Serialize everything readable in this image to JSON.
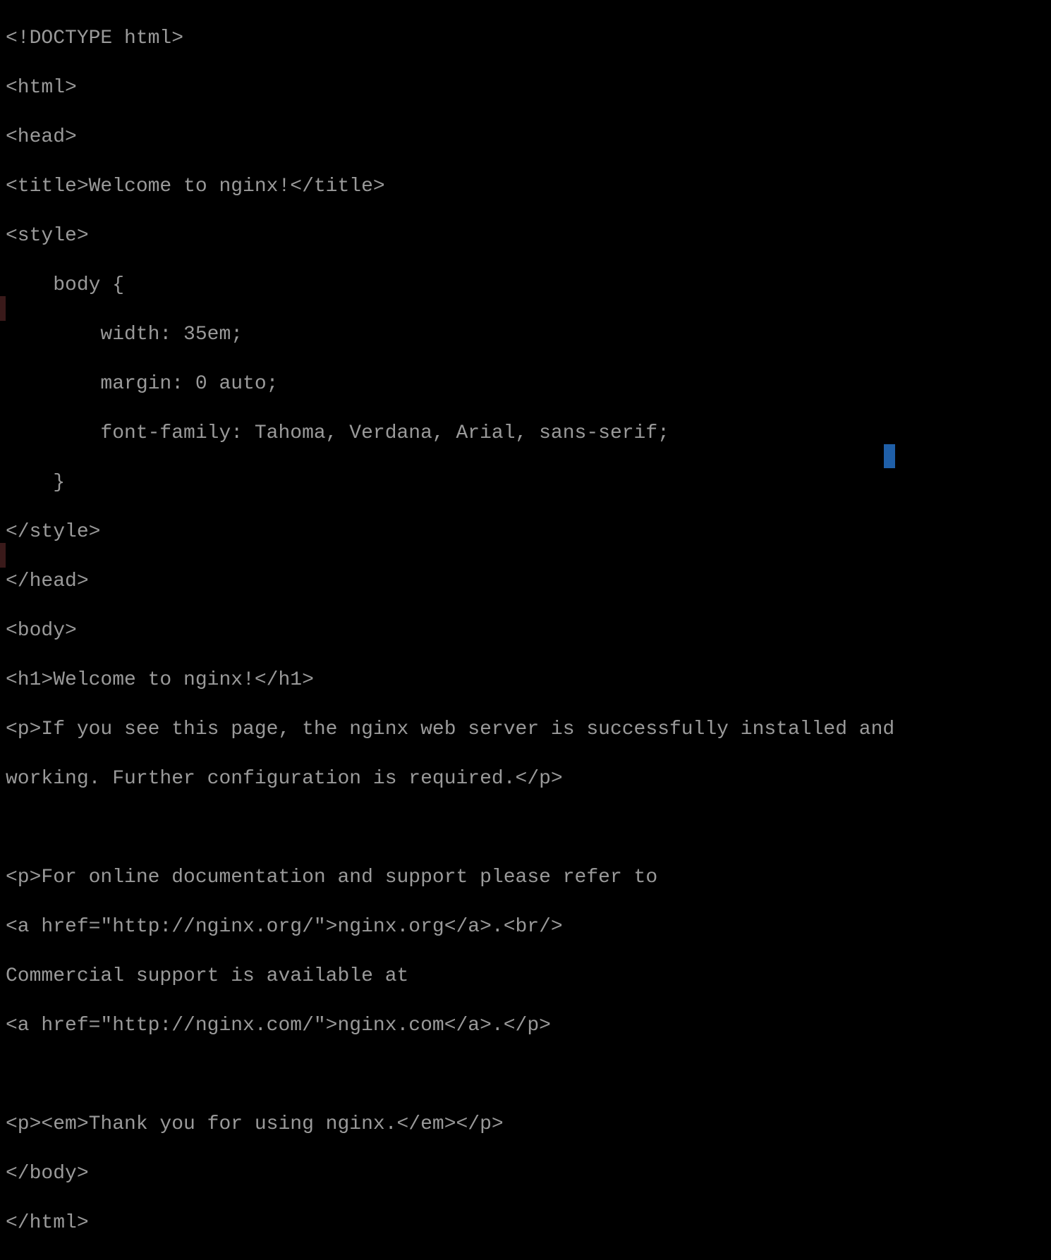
{
  "lines": [
    "<!DOCTYPE html>",
    "<html>",
    "<head>",
    "<title>Welcome to nginx!</title>",
    "<style>",
    "    body {",
    "        width: 35em;",
    "        margin: 0 auto;",
    "        font-family: Tahoma, Verdana, Arial, sans-serif;",
    "    }",
    "</style>",
    "</head>",
    "<body>",
    "<h1>Welcome to nginx!</h1>",
    "<p>If you see this page, the nginx web server is successfully installed and",
    "working. Further configuration is required.</p>",
    "",
    "<p>For online documentation and support please refer to",
    "<a href=\"http://nginx.org/\">nginx.org</a>.<br/>",
    "Commercial support is available at",
    "<a href=\"http://nginx.com/\">nginx.com</a>.</p>",
    "",
    "<p><em>Thank you for using nginx.</em></p>",
    "</body>",
    "</html>"
  ]
}
